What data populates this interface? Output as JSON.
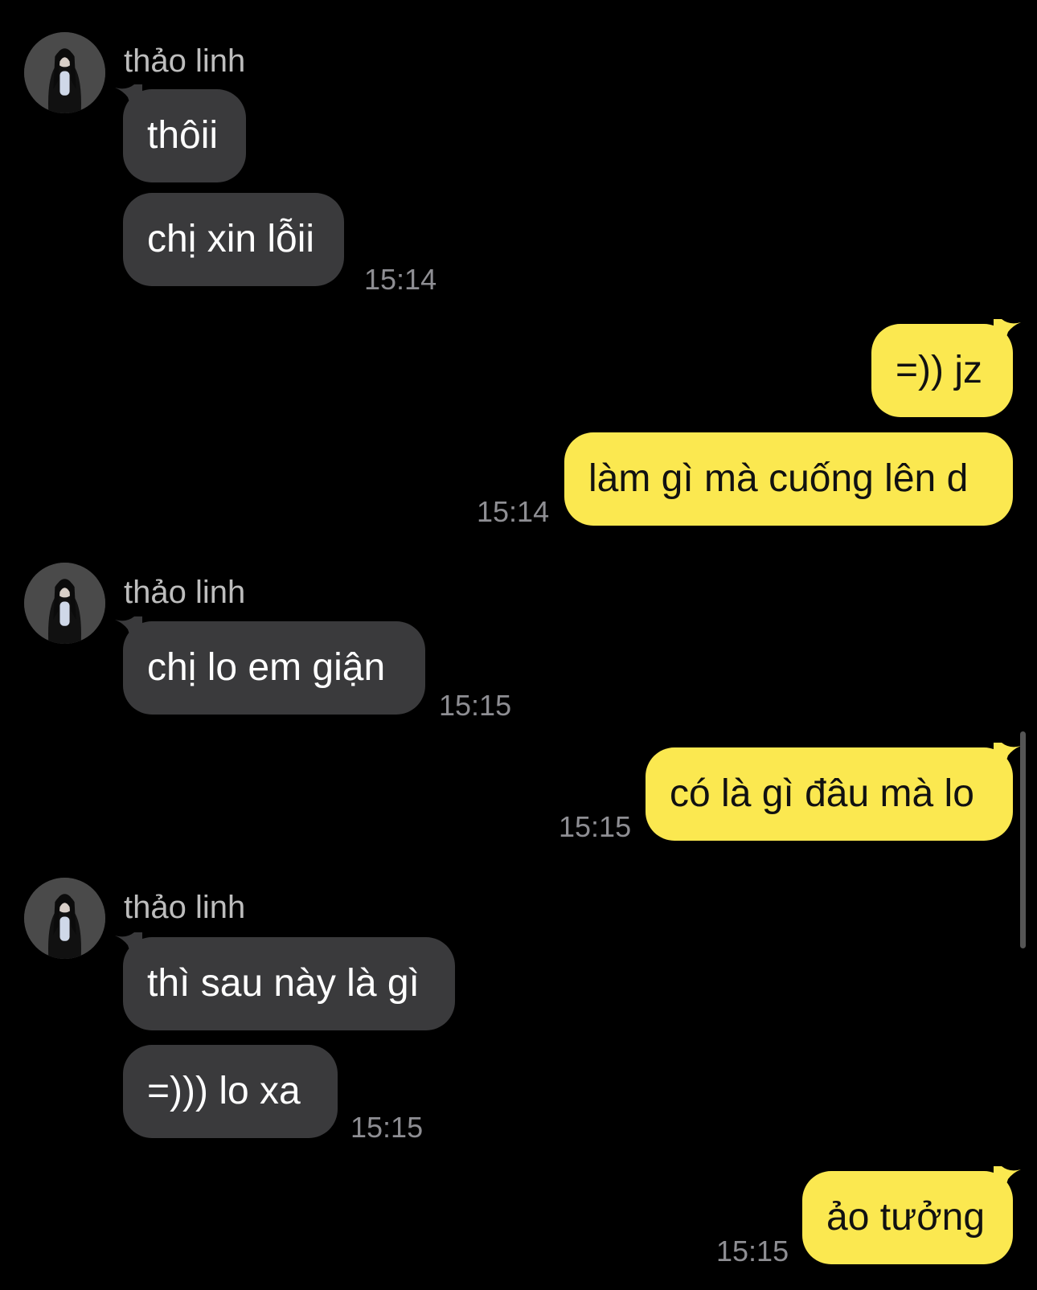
{
  "contact": {
    "name": "thảo linh"
  },
  "messages": [
    {
      "text": "thôii"
    },
    {
      "text": "chị xin lỗii",
      "time": "15:14"
    },
    {
      "text": "=)) jz"
    },
    {
      "text": "làm gì mà cuống lên d",
      "time": "15:14"
    },
    {
      "text": "chị lo em giận",
      "time": "15:15"
    },
    {
      "text": "có là gì đâu mà lo",
      "time": "15:15"
    },
    {
      "text": "thì sau này là gì"
    },
    {
      "text": "=))) lo xa",
      "time": "15:15"
    },
    {
      "text": "ảo tưởng",
      "time": "15:15"
    }
  ],
  "colors": {
    "background": "#000000",
    "incoming_bubble": "#3a3a3c",
    "outgoing_bubble": "#fbe850",
    "timestamp": "#8e8e93",
    "sender_name": "#bdbdbd"
  },
  "icons": {
    "avatar": "profile-photo"
  }
}
